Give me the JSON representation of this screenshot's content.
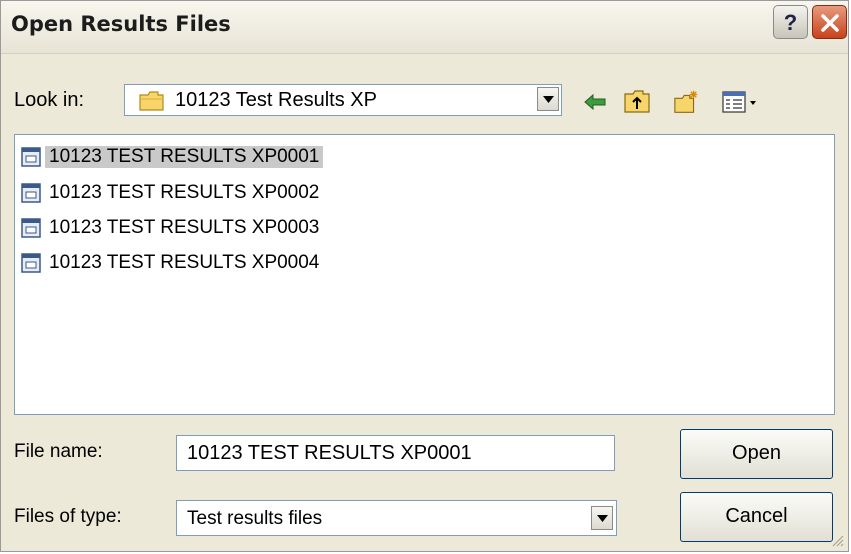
{
  "window": {
    "title": "Open Results Files",
    "help_label": "?"
  },
  "look_in": {
    "label": "Look in:",
    "value": "10123 Test Results XP"
  },
  "toolbar_icons": [
    "back-arrow-icon",
    "up-folder-icon",
    "new-folder-icon",
    "view-menu-icon"
  ],
  "files": [
    {
      "name": "10123 TEST RESULTS XP0001",
      "selected": true
    },
    {
      "name": "10123 TEST RESULTS XP0002",
      "selected": false
    },
    {
      "name": "10123 TEST RESULTS XP0003",
      "selected": false
    },
    {
      "name": "10123 TEST RESULTS XP0004",
      "selected": false
    }
  ],
  "file_name": {
    "label": "File name:",
    "value": "10123 TEST RESULTS XP0001"
  },
  "file_type": {
    "label": "Files of type:",
    "value": "Test results files"
  },
  "buttons": {
    "open": "Open",
    "cancel": "Cancel"
  },
  "colors": {
    "selection": "#c9c9c9",
    "dialog_bg": "#ece9d8",
    "close_button": "#c8421c",
    "border": "#7f9db9"
  }
}
